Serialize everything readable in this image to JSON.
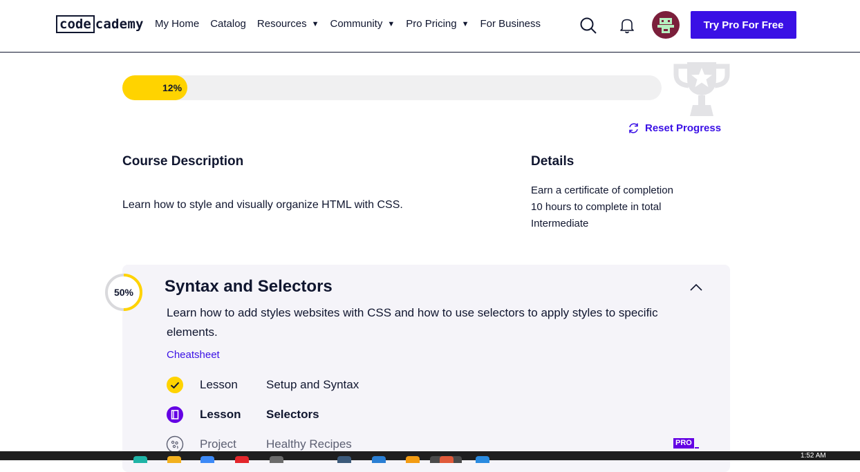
{
  "header": {
    "logo_code": "code",
    "logo_cademy": "cademy",
    "nav": [
      {
        "label": "My Home",
        "caret": false
      },
      {
        "label": "Catalog",
        "caret": false
      },
      {
        "label": "Resources",
        "caret": true
      },
      {
        "label": "Community",
        "caret": true
      },
      {
        "label": "Pro Pricing",
        "caret": true
      },
      {
        "label": "For Business",
        "caret": false
      }
    ],
    "try_pro_label": "Try Pro For Free",
    "accent": "#3a10e5"
  },
  "progress": {
    "percent": 12,
    "label": "12%",
    "fill_color": "#ffd300",
    "reset_label": "Reset Progress"
  },
  "course": {
    "description_heading": "Course Description",
    "description": "Learn how to style and visually organize HTML with CSS.",
    "details_heading": "Details",
    "details": [
      "Earn a certificate of completion",
      "10 hours to complete in total",
      "Intermediate"
    ]
  },
  "module": {
    "percent": 50,
    "percent_label": "50%",
    "title": "Syntax and Selectors",
    "description": "Learn how to add styles websites with CSS and how to use selectors to apply styles to specific elements.",
    "cheatsheet_label": "Cheatsheet",
    "items": [
      {
        "type": "Lesson",
        "name": "Setup and Syntax",
        "icon": "check-circle-icon",
        "status": "complete"
      },
      {
        "type": "Lesson",
        "name": "Selectors",
        "icon": "lesson-book-icon",
        "status": "current"
      },
      {
        "type": "Project",
        "name": "Healthy Recipes",
        "icon": "project-icon",
        "status": "locked"
      }
    ],
    "pro_badge": "PRO"
  },
  "taskbar": {
    "clock": "1:52 AM"
  }
}
